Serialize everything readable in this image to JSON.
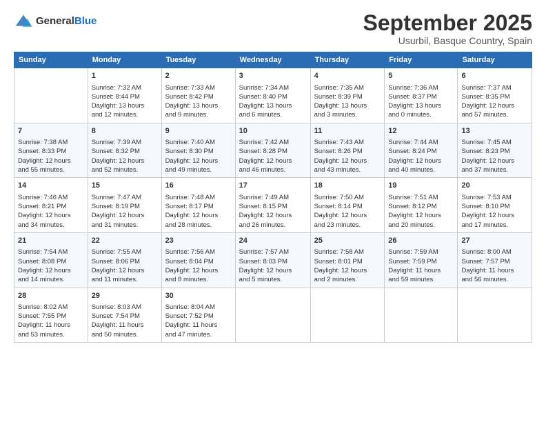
{
  "logo": {
    "general": "General",
    "blue": "Blue"
  },
  "title": "September 2025",
  "subtitle": "Usurbil, Basque Country, Spain",
  "headers": [
    "Sunday",
    "Monday",
    "Tuesday",
    "Wednesday",
    "Thursday",
    "Friday",
    "Saturday"
  ],
  "weeks": [
    [
      {
        "day": "",
        "content": ""
      },
      {
        "day": "1",
        "content": "Sunrise: 7:32 AM\nSunset: 8:44 PM\nDaylight: 13 hours\nand 12 minutes."
      },
      {
        "day": "2",
        "content": "Sunrise: 7:33 AM\nSunset: 8:42 PM\nDaylight: 13 hours\nand 9 minutes."
      },
      {
        "day": "3",
        "content": "Sunrise: 7:34 AM\nSunset: 8:40 PM\nDaylight: 13 hours\nand 6 minutes."
      },
      {
        "day": "4",
        "content": "Sunrise: 7:35 AM\nSunset: 8:39 PM\nDaylight: 13 hours\nand 3 minutes."
      },
      {
        "day": "5",
        "content": "Sunrise: 7:36 AM\nSunset: 8:37 PM\nDaylight: 13 hours\nand 0 minutes."
      },
      {
        "day": "6",
        "content": "Sunrise: 7:37 AM\nSunset: 8:35 PM\nDaylight: 12 hours\nand 57 minutes."
      }
    ],
    [
      {
        "day": "7",
        "content": "Sunrise: 7:38 AM\nSunset: 8:33 PM\nDaylight: 12 hours\nand 55 minutes."
      },
      {
        "day": "8",
        "content": "Sunrise: 7:39 AM\nSunset: 8:32 PM\nDaylight: 12 hours\nand 52 minutes."
      },
      {
        "day": "9",
        "content": "Sunrise: 7:40 AM\nSunset: 8:30 PM\nDaylight: 12 hours\nand 49 minutes."
      },
      {
        "day": "10",
        "content": "Sunrise: 7:42 AM\nSunset: 8:28 PM\nDaylight: 12 hours\nand 46 minutes."
      },
      {
        "day": "11",
        "content": "Sunrise: 7:43 AM\nSunset: 8:26 PM\nDaylight: 12 hours\nand 43 minutes."
      },
      {
        "day": "12",
        "content": "Sunrise: 7:44 AM\nSunset: 8:24 PM\nDaylight: 12 hours\nand 40 minutes."
      },
      {
        "day": "13",
        "content": "Sunrise: 7:45 AM\nSunset: 8:23 PM\nDaylight: 12 hours\nand 37 minutes."
      }
    ],
    [
      {
        "day": "14",
        "content": "Sunrise: 7:46 AM\nSunset: 8:21 PM\nDaylight: 12 hours\nand 34 minutes."
      },
      {
        "day": "15",
        "content": "Sunrise: 7:47 AM\nSunset: 8:19 PM\nDaylight: 12 hours\nand 31 minutes."
      },
      {
        "day": "16",
        "content": "Sunrise: 7:48 AM\nSunset: 8:17 PM\nDaylight: 12 hours\nand 28 minutes."
      },
      {
        "day": "17",
        "content": "Sunrise: 7:49 AM\nSunset: 8:15 PM\nDaylight: 12 hours\nand 26 minutes."
      },
      {
        "day": "18",
        "content": "Sunrise: 7:50 AM\nSunset: 8:14 PM\nDaylight: 12 hours\nand 23 minutes."
      },
      {
        "day": "19",
        "content": "Sunrise: 7:51 AM\nSunset: 8:12 PM\nDaylight: 12 hours\nand 20 minutes."
      },
      {
        "day": "20",
        "content": "Sunrise: 7:53 AM\nSunset: 8:10 PM\nDaylight: 12 hours\nand 17 minutes."
      }
    ],
    [
      {
        "day": "21",
        "content": "Sunrise: 7:54 AM\nSunset: 8:08 PM\nDaylight: 12 hours\nand 14 minutes."
      },
      {
        "day": "22",
        "content": "Sunrise: 7:55 AM\nSunset: 8:06 PM\nDaylight: 12 hours\nand 11 minutes."
      },
      {
        "day": "23",
        "content": "Sunrise: 7:56 AM\nSunset: 8:04 PM\nDaylight: 12 hours\nand 8 minutes."
      },
      {
        "day": "24",
        "content": "Sunrise: 7:57 AM\nSunset: 8:03 PM\nDaylight: 12 hours\nand 5 minutes."
      },
      {
        "day": "25",
        "content": "Sunrise: 7:58 AM\nSunset: 8:01 PM\nDaylight: 12 hours\nand 2 minutes."
      },
      {
        "day": "26",
        "content": "Sunrise: 7:59 AM\nSunset: 7:59 PM\nDaylight: 11 hours\nand 59 minutes."
      },
      {
        "day": "27",
        "content": "Sunrise: 8:00 AM\nSunset: 7:57 PM\nDaylight: 11 hours\nand 56 minutes."
      }
    ],
    [
      {
        "day": "28",
        "content": "Sunrise: 8:02 AM\nSunset: 7:55 PM\nDaylight: 11 hours\nand 53 minutes."
      },
      {
        "day": "29",
        "content": "Sunrise: 8:03 AM\nSunset: 7:54 PM\nDaylight: 11 hours\nand 50 minutes."
      },
      {
        "day": "30",
        "content": "Sunrise: 8:04 AM\nSunset: 7:52 PM\nDaylight: 11 hours\nand 47 minutes."
      },
      {
        "day": "",
        "content": ""
      },
      {
        "day": "",
        "content": ""
      },
      {
        "day": "",
        "content": ""
      },
      {
        "day": "",
        "content": ""
      }
    ]
  ]
}
